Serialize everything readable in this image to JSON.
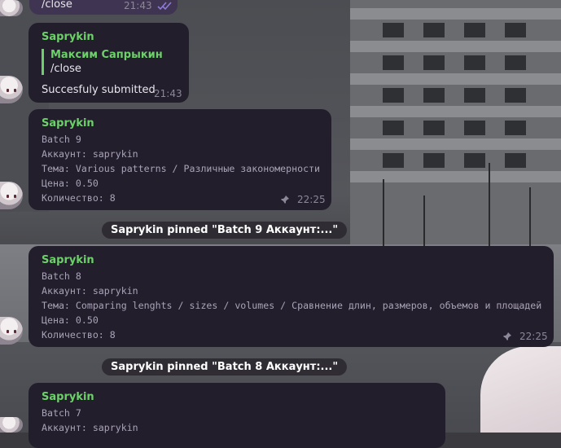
{
  "messages": {
    "top_outgoing": {
      "text": "/close",
      "time": "21:43"
    },
    "reply": {
      "sender": "Saprykin",
      "quote_name": "Максим Сапрыкин",
      "quote_text": "/close",
      "text": "Succesfuly submitted",
      "time": "21:43"
    },
    "batch9": {
      "sender": "Saprykin",
      "lines": [
        "Batch 9",
        "Аккаунт: saprykin",
        "Тема: Various patterns / Различные закономерности",
        "Цена: 0.50",
        "Количество: 8"
      ],
      "time": "22:25"
    },
    "pin9": {
      "text": "Saprykin pinned \"Batch 9 Аккаунт:...\""
    },
    "batch8": {
      "sender": "Saprykin",
      "lines": [
        "Batch 8",
        "Аккаунт: saprykin",
        "Тема: Comparing lenghts / sizes / volumes / Сравнение длин, размеров, объемов и площадей",
        "Цена: 0.50",
        "Количество: 8"
      ],
      "time": "22:25"
    },
    "pin8": {
      "text": "Saprykin pinned \"Batch 8 Аккаунт:...\""
    },
    "batch7": {
      "sender": "Saprykin",
      "lines": [
        "Batch 7",
        "Аккаунт: saprykin"
      ]
    }
  },
  "icons": {
    "read_status": "double-check-icon",
    "pinned": "pin-icon"
  },
  "colors": {
    "sender": "#6dd16a",
    "bubble_in": "#231e2c",
    "bubble_out": "#3f3452",
    "read_check": "#8e7ad8"
  }
}
